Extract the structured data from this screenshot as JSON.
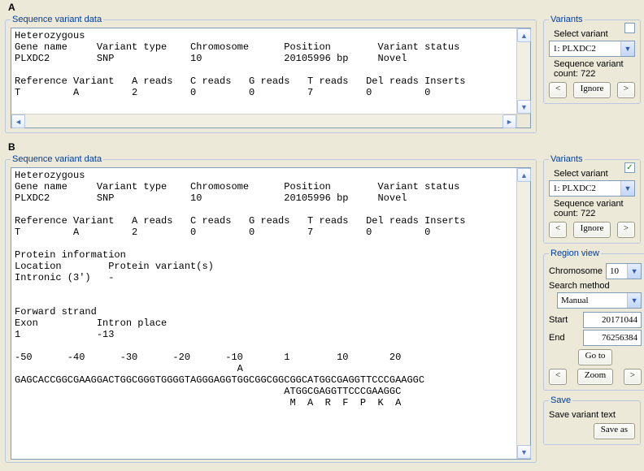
{
  "panelA": {
    "label": "A",
    "legend": "Sequence variant data",
    "text": "Heterozygous\nGene name     Variant type    Chromosome      Position        Variant status\nPLXDC2        SNP             10              20105996 bp     Novel\n\nReference Variant   A reads   C reads   G reads   T reads   Del reads Inserts\nT         A         2         0         0         7         0         0",
    "variants": {
      "legend": "Variants",
      "selectLabel": "Select variant",
      "selected": "1: PLXDC2",
      "countLabel": "Sequence variant count: 722",
      "prev": "<",
      "ignore": "Ignore",
      "next": ">",
      "checked": false
    }
  },
  "panelB": {
    "label": "B",
    "legend": "Sequence variant data",
    "text": "Heterozygous\nGene name     Variant type    Chromosome      Position        Variant status\nPLXDC2        SNP             10              20105996 bp     Novel\n\nReference Variant   A reads   C reads   G reads   T reads   Del reads Inserts\nT         A         2         0         0         7         0         0\n\nProtein information\nLocation        Protein variant(s)\nIntronic (3')   -\n\n\nForward strand\nExon          Intron place\n1             -13\n\n-50      -40      -30      -20      -10       1        10       20\n                                      A\nGAGCACCGGCGAAGGACTGGCGGGTGGGGTAGGGAGGTGGCGGCGGCGGCATGGCGAGGTTCCCGAAGGC\n                                              ATGGCGAGGTTCCCGAAGGC\n                                               M  A  R  F  P  K  A",
    "variants": {
      "legend": "Variants",
      "selectLabel": "Select variant",
      "selected": "1: PLXDC2",
      "countLabel": "Sequence variant count: 722",
      "prev": "<",
      "ignore": "Ignore",
      "next": ">",
      "checked": true
    },
    "region": {
      "legend": "Region view",
      "chromosomeLabel": "Chromosome",
      "chromosome": "10",
      "searchMethodLabel": "Search method",
      "searchMethod": "Manual",
      "startLabel": "Start",
      "start": "20171044",
      "endLabel": "End",
      "end": "76256384",
      "goTo": "Go to",
      "prev": "<",
      "zoom": "Zoom",
      "next": ">"
    },
    "save": {
      "legend": "Save",
      "label": "Save variant text",
      "button": "Save as"
    }
  }
}
